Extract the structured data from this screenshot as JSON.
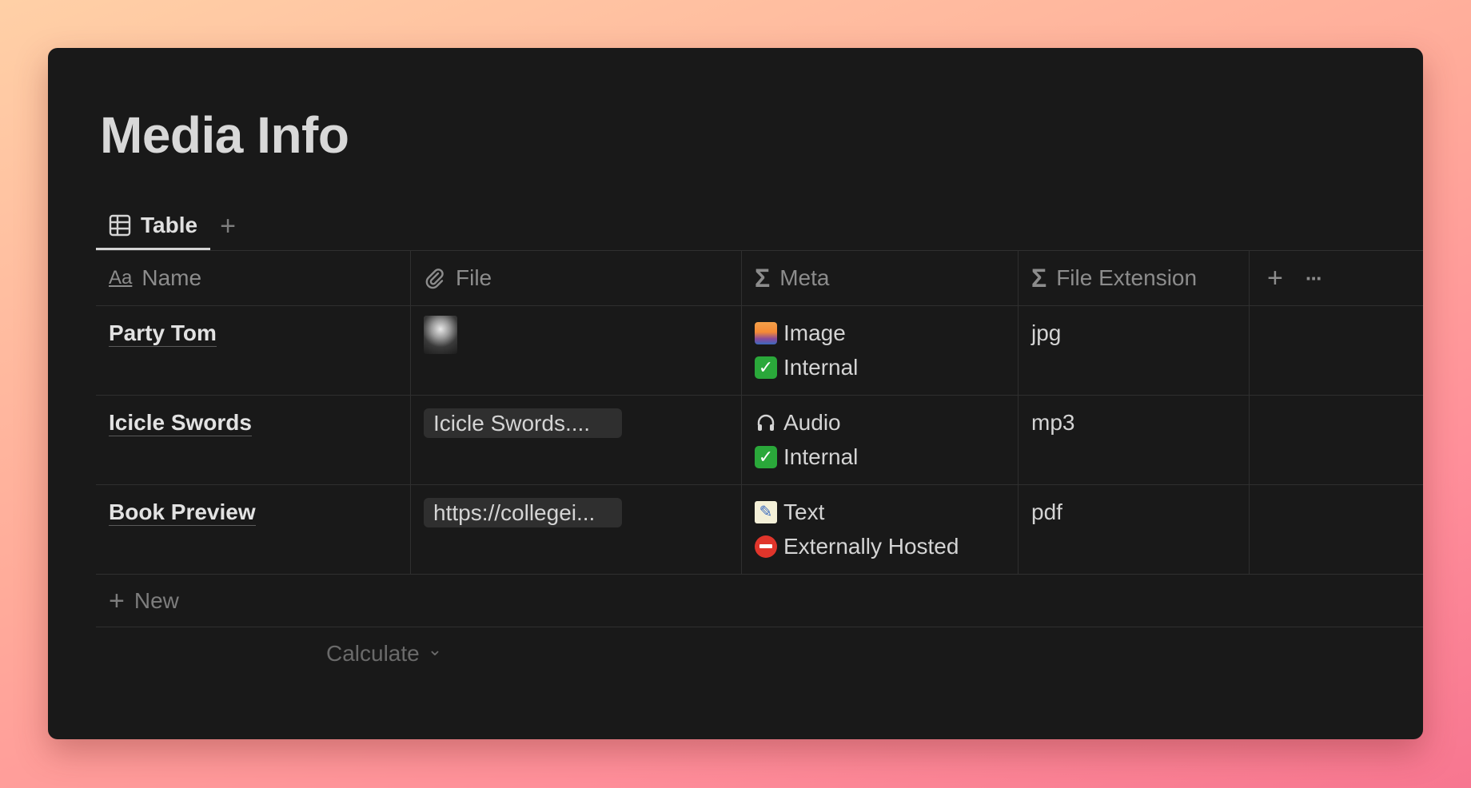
{
  "page": {
    "title": "Media Info"
  },
  "views": {
    "tabs": [
      {
        "label": "Table",
        "icon": "table-icon"
      }
    ],
    "add_icon": "+"
  },
  "table": {
    "columns": [
      {
        "label": "Name",
        "icon": "Aa"
      },
      {
        "label": "File",
        "icon": "paperclip-icon"
      },
      {
        "label": "Meta",
        "icon": "Σ"
      },
      {
        "label": "File Extension",
        "icon": "Σ"
      }
    ],
    "header_actions": {
      "add": "+",
      "more": "···"
    },
    "rows": [
      {
        "name": "Party Tom",
        "file": {
          "type": "thumbnail",
          "label": ""
        },
        "meta": [
          {
            "icon": "image-emoji",
            "text": "Image"
          },
          {
            "icon": "check-emoji",
            "text": "Internal"
          }
        ],
        "extension": "jpg"
      },
      {
        "name": "Icicle Swords",
        "file": {
          "type": "chip",
          "label": "Icicle Swords...."
        },
        "meta": [
          {
            "icon": "headphones-emoji",
            "text": "Audio"
          },
          {
            "icon": "check-emoji",
            "text": "Internal"
          }
        ],
        "extension": "mp3"
      },
      {
        "name": "Book Preview",
        "file": {
          "type": "chip",
          "label": "https://collegei..."
        },
        "meta": [
          {
            "icon": "memo-emoji",
            "text": "Text"
          },
          {
            "icon": "no-entry-emoji",
            "text": "Externally Hosted"
          }
        ],
        "extension": "pdf"
      }
    ],
    "new_row_label": "New",
    "calculate_label": "Calculate",
    "calculate_chevron": "⌄"
  },
  "colors": {
    "window_bg": "#191919",
    "border": "#2f2f2f",
    "text": "#d4d4d4",
    "muted": "#8c8c8c",
    "chip_bg": "#2f2f2f"
  }
}
